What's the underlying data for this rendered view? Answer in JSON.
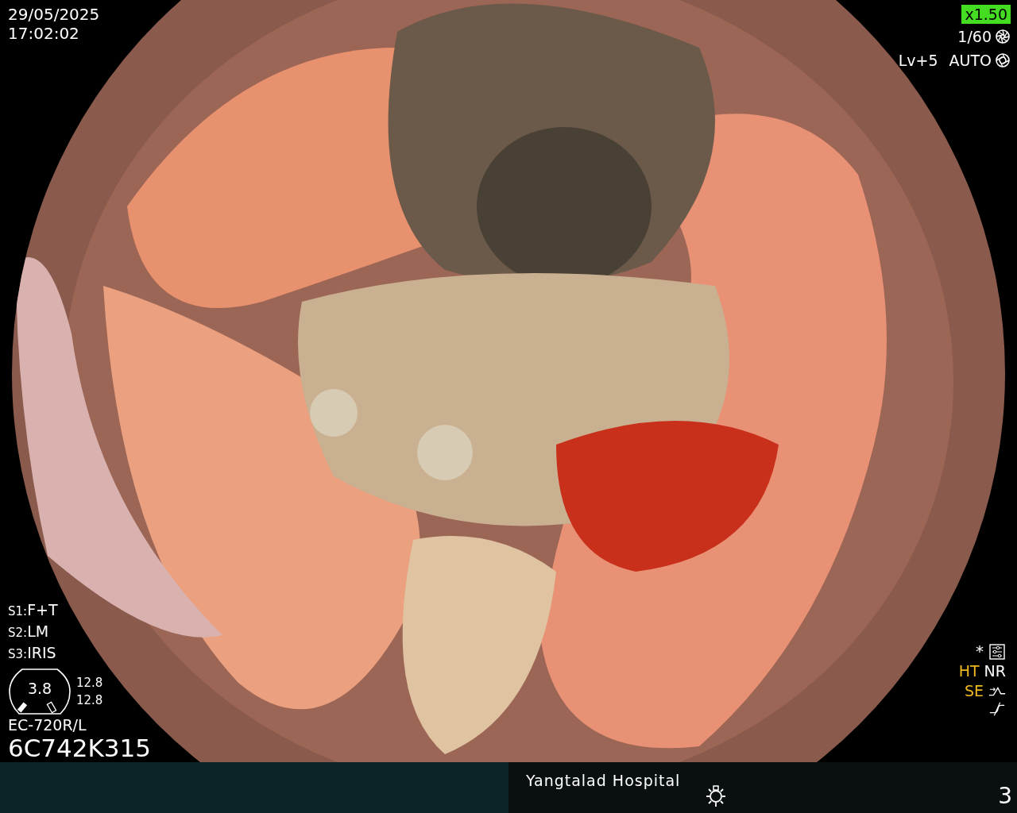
{
  "datetime": {
    "date": "29/05/2025",
    "time": "17:02:02"
  },
  "camera": {
    "zoom": "x1.50",
    "shutter": "1/60",
    "level": "Lv+5",
    "iris": "AUTO"
  },
  "switches": [
    {
      "key": "S1:",
      "value": "F+T"
    },
    {
      "key": "S2:",
      "value": "LM"
    },
    {
      "key": "S3:",
      "value": "IRIS"
    }
  ],
  "gauge": {
    "value": "3.8",
    "readings": [
      "12.8",
      "12.8"
    ]
  },
  "scope": {
    "model": "EC-720R/L",
    "serial": "6C742K315"
  },
  "settings": {
    "mark": "*",
    "modes": [
      {
        "label": "HT",
        "on": true
      },
      {
        "label": "NR",
        "on": false
      },
      {
        "label": "SE",
        "on": true
      }
    ]
  },
  "footer": {
    "hospital": "Yangtalad Hospital",
    "count": "3"
  }
}
